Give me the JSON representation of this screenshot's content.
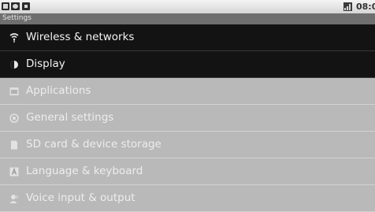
{
  "status_bar": {
    "clock": "08:0"
  },
  "title_bar": {
    "title": "Settings"
  },
  "settings_list": {
    "items": [
      {
        "label": "Wireless & networks",
        "icon": "wifi-icon",
        "selected": true
      },
      {
        "label": "Display",
        "icon": "display-icon",
        "selected": true
      },
      {
        "label": "Applications",
        "icon": "applications-icon",
        "selected": false
      },
      {
        "label": "General settings",
        "icon": "gear-icon",
        "selected": false
      },
      {
        "label": "SD card & device storage",
        "icon": "sd-card-icon",
        "selected": false
      },
      {
        "label": "Language & keyboard",
        "icon": "keyboard-icon",
        "selected": false
      },
      {
        "label": "Voice input & output",
        "icon": "voice-icon",
        "selected": false
      }
    ]
  },
  "colors": {
    "selected_row_bg": "#131313",
    "row_bg": "#b9b9b9",
    "title_bar_bg": "#6f6f6f"
  }
}
